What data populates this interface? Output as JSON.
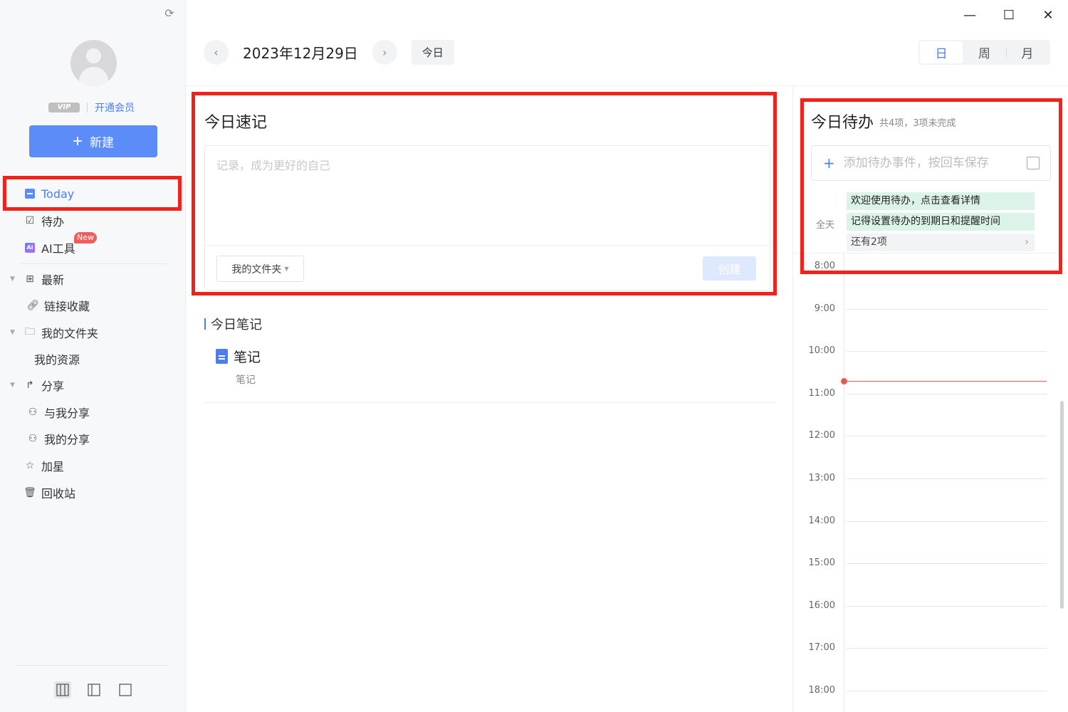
{
  "sidebar": {
    "vip_badge": "VIP",
    "vip_link": "开通会员",
    "new_button": "新建",
    "items": [
      {
        "label": "Today"
      },
      {
        "label": "待办"
      },
      {
        "label": "AI工具",
        "tag": "New"
      },
      {
        "label": "最新"
      },
      {
        "label": "链接收藏"
      },
      {
        "label": "我的文件夹"
      },
      {
        "label": "我的资源"
      },
      {
        "label": "分享"
      },
      {
        "label": "与我分享"
      },
      {
        "label": "我的分享"
      },
      {
        "label": "加星"
      },
      {
        "label": "回收站"
      }
    ],
    "active_index": 0
  },
  "header": {
    "date": "2023年12月29日",
    "today_button": "今日",
    "views": [
      "日",
      "周",
      "月"
    ],
    "active_view": "日"
  },
  "quick_note": {
    "title": "今日速记",
    "placeholder": "记录，成为更好的自己",
    "folder": "我的文件夹",
    "create_button": "创建"
  },
  "today_notes": {
    "title": "今日笔记",
    "items": [
      {
        "title": "笔记",
        "subtitle": "笔记"
      }
    ]
  },
  "todo": {
    "title": "今日待办",
    "summary": "共4项，3项未完成",
    "input_placeholder": "添加待办事件，按回车保存",
    "all_day_label": "全天",
    "events": [
      "欢迎使用待办，点击查看详情",
      "记得设置待办的到期日和提醒时间"
    ],
    "more": "还有2项",
    "hours": [
      "8:00",
      "9:00",
      "10:00",
      "11:00",
      "12:00",
      "13:00",
      "14:00",
      "15:00",
      "16:00",
      "17:00",
      "18:00"
    ]
  },
  "colors": {
    "accent": "#4a7ef7",
    "highlight_box": "#f0221b",
    "event_bg": "#dcf3ea",
    "now_line": "#e45a5a"
  },
  "icons": [
    "sync-icon",
    "avatar",
    "plus-icon",
    "calendar-icon",
    "todo-icon",
    "ai-icon",
    "grid-icon",
    "link-icon",
    "folder-icon",
    "share-icon",
    "user-share-icon",
    "star-icon",
    "trash-icon",
    "chevron-left-icon",
    "chevron-right-icon",
    "document-icon",
    "minimize-icon",
    "maximize-icon",
    "close-icon"
  ]
}
